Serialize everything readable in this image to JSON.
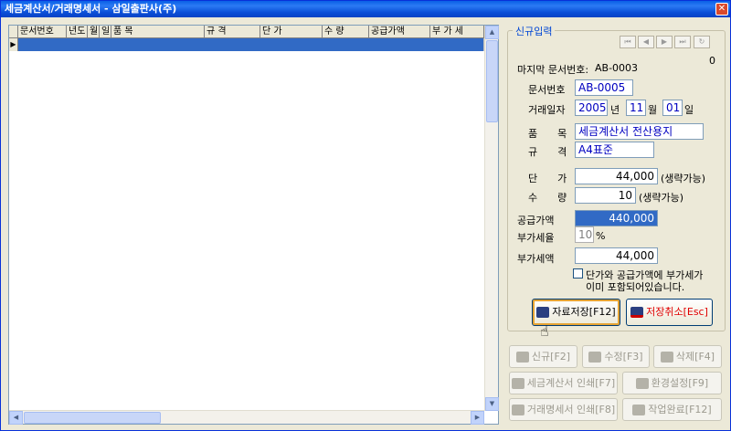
{
  "window": {
    "title": "세금계산서/거래명세서 - 삼일출판사(주)",
    "close_glyph": "✕"
  },
  "grid": {
    "columns": [
      "문서번호",
      "년도",
      "월",
      "일",
      "품 목",
      "규 격",
      "단 가",
      "수 량",
      "공급가액",
      "부 가 세"
    ],
    "row_indicator": "▶"
  },
  "panel": {
    "group_title": "신규입력",
    "counter": "0",
    "last_doc_label": "마지막 문서번호:",
    "last_doc_value": "AB-0003",
    "doc_no_label": "문서번호",
    "doc_no_value": "AB-0005",
    "date_label": "거래일자",
    "year_value": "2005",
    "year_unit": "년",
    "month_value": "11",
    "month_unit": "월",
    "day_value": "01",
    "day_unit": "일",
    "item_label": "품　　목",
    "item_value": "세금계산서 전산용지",
    "spec_label": "규　　격",
    "spec_value": "A4표준",
    "price_label": "단　　가",
    "price_value": "44,000",
    "price_note": "(생략가능)",
    "qty_label": "수　　량",
    "qty_value": "10",
    "qty_note": "(생략가능)",
    "supply_label": "공급가액",
    "supply_value": "440,000",
    "vat_rate_label": "부가세율",
    "vat_rate_value": "10",
    "vat_rate_unit": "%",
    "vat_label": "부가세액",
    "vat_value": "44,000",
    "vat_included_line1": "단가와 공급가액에 부가세가",
    "vat_included_line2": "이미 포함되어있습니다."
  },
  "buttons": {
    "save": "자료저장[F12]",
    "cancel_save": "저장취소[Esc]",
    "new": "신규[F2]",
    "edit": "수정[F3]",
    "delete": "삭제[F4]",
    "print_tax": "세금계산서 인쇄[F7]",
    "settings": "환경설정[F9]",
    "print_statement": "거래명세서 인쇄[F8]",
    "finish": "작업완료[F12]"
  },
  "colors": {
    "accent": "#316ac5",
    "group_title": "#0046d5",
    "cancel_text": "#e00000",
    "field_text": "#0000c0"
  }
}
